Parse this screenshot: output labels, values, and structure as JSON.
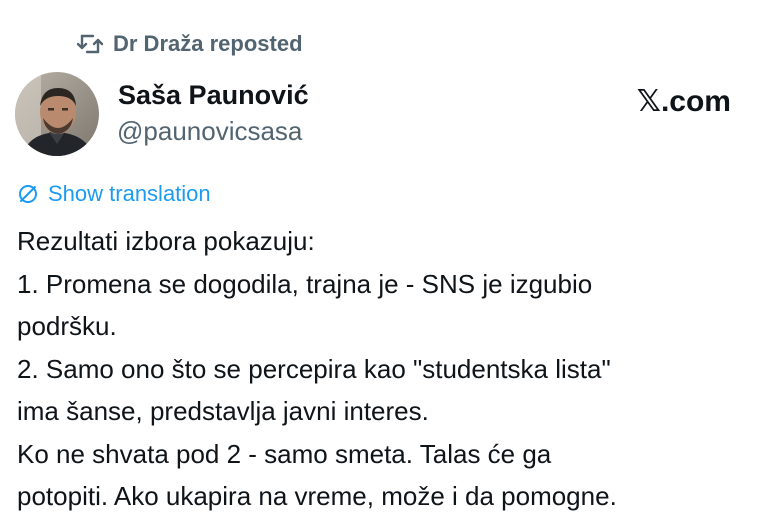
{
  "repost": {
    "label": "Dr Draža reposted",
    "icon": "repost-icon"
  },
  "author": {
    "name": "Saša Paunović",
    "handle": "@paunovicsasa",
    "avatar": "avatar-photo"
  },
  "brand": {
    "label": "𝕏.com"
  },
  "translation": {
    "label": "Show translation",
    "icon": "globe-icon",
    "color": "#1d9bf0"
  },
  "tweet": {
    "lines": [
      "Rezultati izbora pokazuju:",
      "1. Promena se dogodila, trajna je - SNS je izgubio",
      "podršku.",
      "2. Samo ono što se percepira kao \"studentska lista\"",
      "ima šanse, predstavlja javni interes.",
      "Ko ne shvata pod 2 - samo smeta. Talas će ga",
      "potopiti. Ako ukapira na vreme, može i da pomogne."
    ]
  },
  "colors": {
    "text": "#0f1419",
    "secondary": "#536471",
    "link": "#1d9bf0"
  }
}
